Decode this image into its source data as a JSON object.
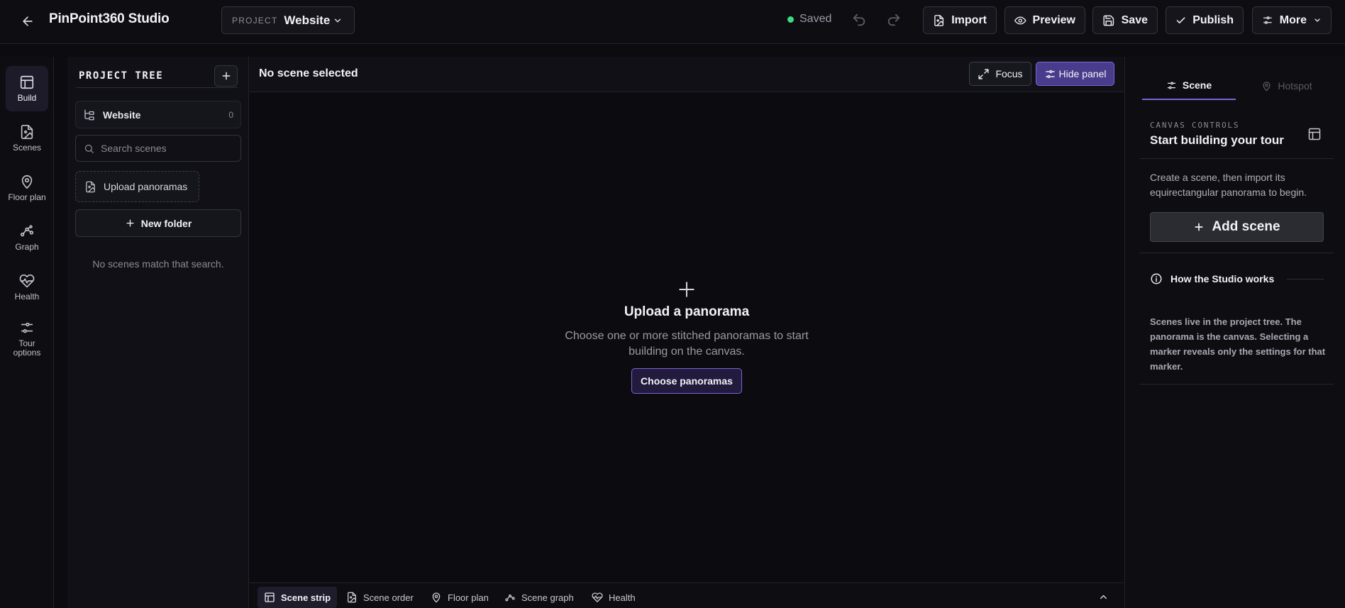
{
  "app": {
    "title": "PinPoint360 Studio"
  },
  "project": {
    "label": "PROJECT",
    "name": "Website"
  },
  "status": {
    "saved": "Saved"
  },
  "toolbar": {
    "import": "Import",
    "preview": "Preview",
    "save": "Save",
    "publish": "Publish",
    "more": "More"
  },
  "rail": {
    "items": [
      {
        "label": "Build",
        "icon": "layout-icon",
        "active": true
      },
      {
        "label": "Scenes",
        "icon": "image-file-icon"
      },
      {
        "label": "Floor plan",
        "icon": "map-pin-icon"
      },
      {
        "label": "Graph",
        "icon": "graph-icon"
      },
      {
        "label": "Health",
        "icon": "heart-pulse-icon"
      },
      {
        "label": "Tour options",
        "icon": "sliders-icon"
      }
    ]
  },
  "tree": {
    "title": "PROJECT TREE",
    "root": {
      "label": "Website",
      "count": "0"
    },
    "search_placeholder": "Search scenes",
    "upload": "Upload panoramas",
    "new_folder": "New folder",
    "empty": "No scenes match that search."
  },
  "canvas": {
    "title": "No scene selected",
    "focus": "Focus",
    "hide_panel": "Hide panel",
    "empty_title": "Upload a panorama",
    "empty_desc": "Choose one or more stitched panoramas to start building on the canvas.",
    "choose": "Choose panoramas"
  },
  "bottombar": {
    "items": [
      {
        "label": "Scene strip",
        "icon": "layout-icon",
        "active": true
      },
      {
        "label": "Scene order",
        "icon": "image-file-icon"
      },
      {
        "label": "Floor plan",
        "icon": "map-pin-icon"
      },
      {
        "label": "Scene graph",
        "icon": "graph-icon"
      },
      {
        "label": "Health",
        "icon": "heart-pulse-icon"
      }
    ]
  },
  "inspector": {
    "tabs": [
      {
        "label": "Scene",
        "icon": "sliders-icon",
        "active": true
      },
      {
        "label": "Hotspot",
        "icon": "map-pin-icon",
        "disabled": true
      }
    ],
    "section_label": "CANVAS CONTROLS",
    "section_title": "Start building your tour",
    "desc": "Create a scene, then import its equirectangular panorama to begin.",
    "add_scene": "Add scene",
    "how_title": "How the Studio works",
    "how_body": "Scenes live in the project tree. The panorama is the canvas. Selecting a marker reveals only the settings for that marker."
  },
  "colors": {
    "accent": "#7d64d6",
    "accent_fill": "#4a3c8c",
    "saved_dot": "#3ddc84",
    "background": "#0b0b10"
  }
}
